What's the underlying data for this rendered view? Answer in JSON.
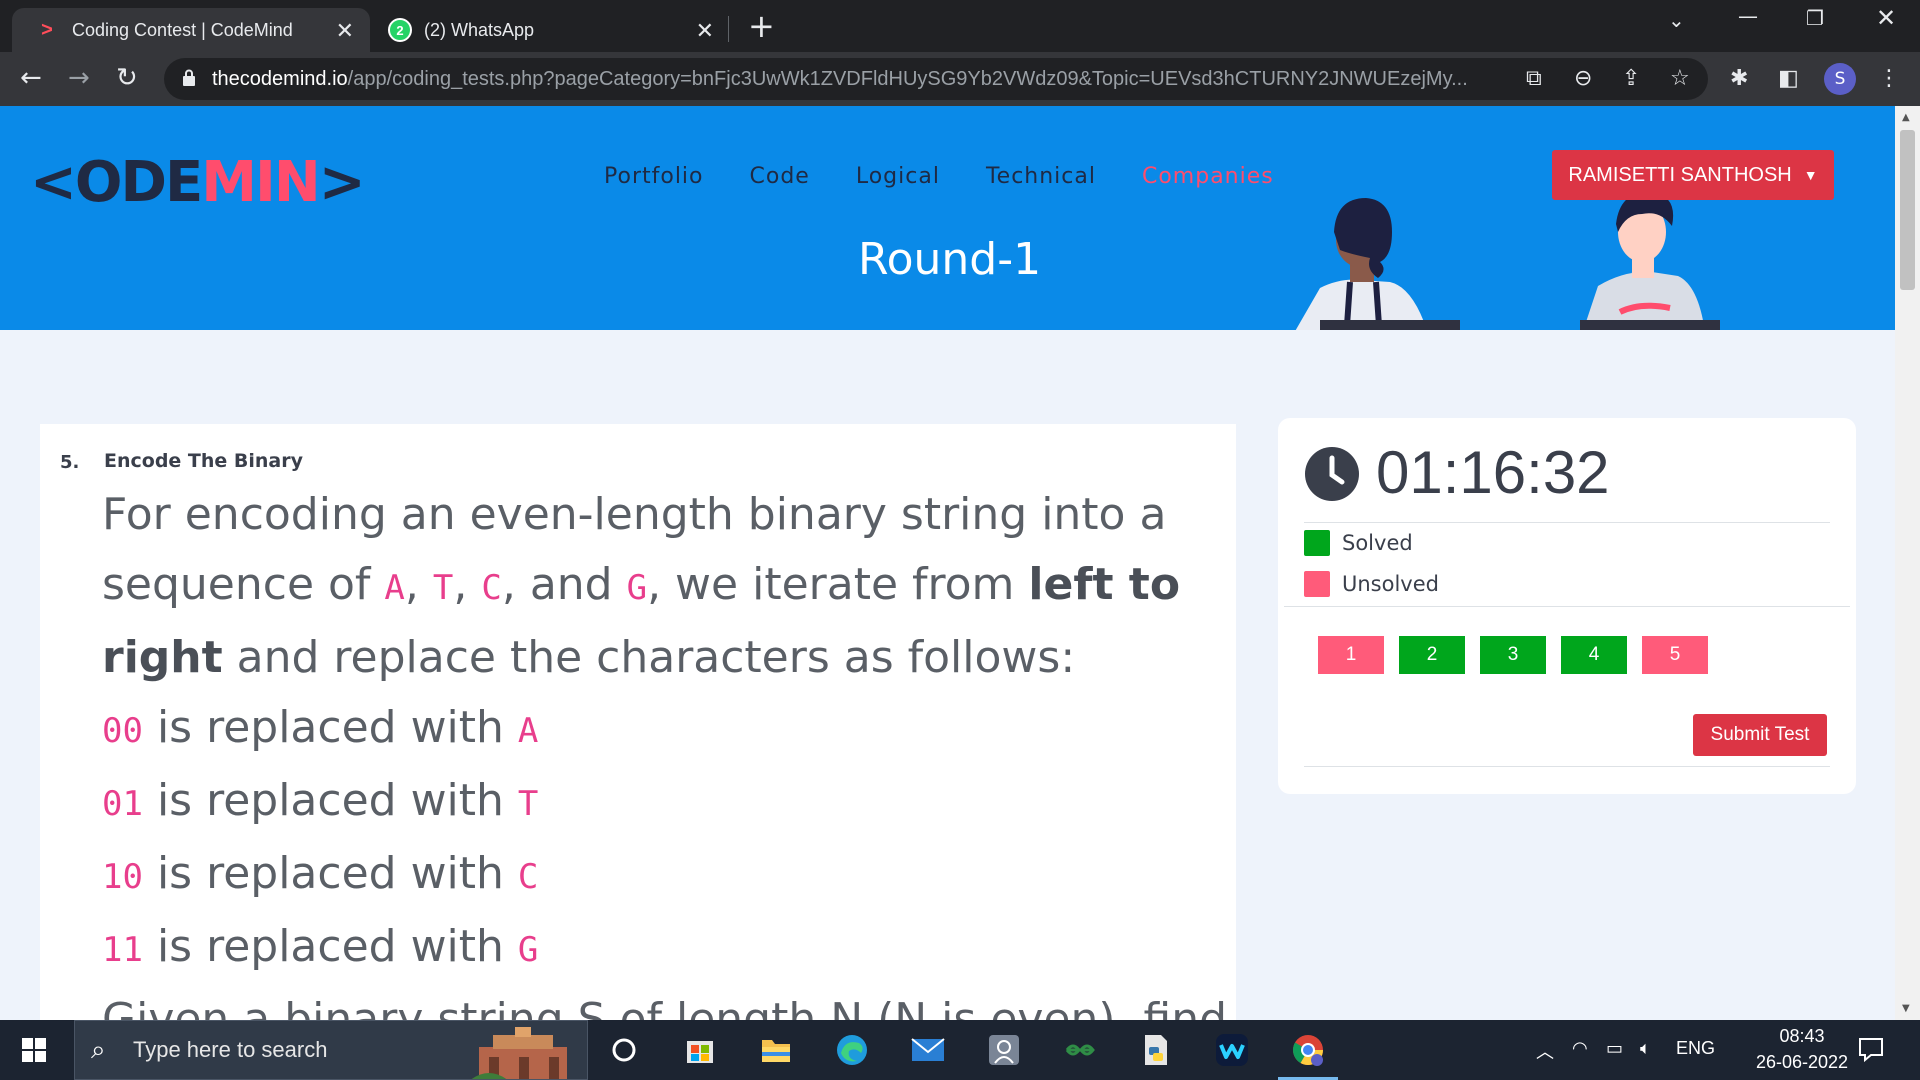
{
  "browser": {
    "tabs": [
      {
        "title": "Coding Contest | CodeMind",
        "favicon": "codemind-icon"
      },
      {
        "title": "(2) WhatsApp",
        "favicon": "whatsapp-icon",
        "badge": "2"
      }
    ],
    "url_host": "thecodemind.io",
    "url_path": "/app/coding_tests.php?pageCategory=bnFjc3UwWk1ZVDFldHUySG9Yb2VWdz09&Topic=UEVsd3hCTURNY2JNWUEzejMy...",
    "profile_initial": "S"
  },
  "site": {
    "logo_prefix": "<ODE",
    "logo_accent": "MIN",
    "logo_suffix": ">",
    "nav": [
      "Portfolio",
      "Code",
      "Logical",
      "Technical",
      "Companies"
    ],
    "active_nav": "Companies",
    "user_name": "RAMISETTI SANTHOSH",
    "page_title": "Round-1"
  },
  "question": {
    "number": "5.",
    "title": "Encode The Binary",
    "intro_1": "For encoding an even-length binary string into a sequence of ",
    "A": "A",
    "T": "T",
    "C": "C",
    "G": "G",
    "intro_2": ", and ",
    "intro_3": ", we iterate from ",
    "intro_bold_1": "left to",
    "intro_bold_2": "right",
    "intro_4": " and replace the characters as follows:",
    "rules": [
      {
        "code": "00",
        "text": " is replaced with ",
        "letter": "A"
      },
      {
        "code": "01",
        "text": " is replaced with ",
        "letter": "T"
      },
      {
        "code": "10",
        "text": " is replaced with ",
        "letter": "C"
      },
      {
        "code": "11",
        "text": " is replaced with ",
        "letter": "G"
      }
    ],
    "cutoff_line": "Given a binary string S of length N (N is even), find"
  },
  "status": {
    "timer": "01:16:32",
    "legend_solved": "Solved",
    "legend_unsolved": "Unsolved",
    "solved_color": "#00a61c",
    "unsolved_color": "#ff5b7a",
    "questions": [
      {
        "label": "1",
        "state": "unsolved"
      },
      {
        "label": "2",
        "state": "solved"
      },
      {
        "label": "3",
        "state": "solved"
      },
      {
        "label": "4",
        "state": "solved"
      },
      {
        "label": "5",
        "state": "unsolved"
      }
    ],
    "submit_label": "Submit Test"
  },
  "taskbar": {
    "search_placeholder": "Type here to search",
    "language": "ENG",
    "time": "08:43",
    "date": "26-06-2022"
  }
}
